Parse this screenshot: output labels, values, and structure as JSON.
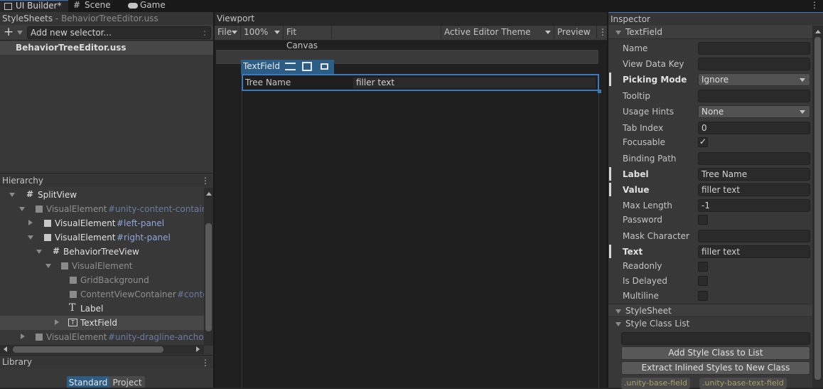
{
  "tabs": [
    {
      "label": "UI Builder*",
      "icon": "ui-builder-icon",
      "active": true
    },
    {
      "label": "Scene",
      "icon": "grid-icon",
      "active": false
    },
    {
      "label": "Game",
      "icon": "gamepad-icon",
      "active": false
    }
  ],
  "stylesheets": {
    "title": "StyleSheets",
    "subtitle": "- BehaviorTreeEditor.uss",
    "selector_placeholder": "Add new selector...",
    "selector_more": ":",
    "file": "BehaviorTreeEditor.uss"
  },
  "hierarchy": {
    "title": "Hierarchy",
    "rows": [
      {
        "name": "SplitView",
        "cls": ""
      },
      {
        "name": "VisualElement",
        "cls": "#unity-content-containe"
      },
      {
        "name": "VisualElement",
        "cls": "#left-panel"
      },
      {
        "name": "VisualElement",
        "cls": "#right-panel"
      },
      {
        "name": "BehaviorTreeView",
        "cls": ""
      },
      {
        "name": "VisualElement",
        "cls": ""
      },
      {
        "name": "GridBackground",
        "cls": ""
      },
      {
        "name": "ContentViewContainer",
        "cls": "#conte"
      },
      {
        "name": "Label",
        "cls": ""
      },
      {
        "name": "TextField",
        "cls": ""
      },
      {
        "name": "VisualElement",
        "cls": "#unity-dragline-anchor"
      }
    ]
  },
  "library": {
    "title": "Library",
    "tab_standard": "Standard",
    "tab_project": "Project"
  },
  "viewport": {
    "title": "Viewport",
    "file": "File",
    "zoom": "100%",
    "fit": "Fit Canvas",
    "theme": "Active Editor Theme",
    "preview": "Preview",
    "selected_label": "TextField",
    "field_label": "Tree Name",
    "field_value": "filler text"
  },
  "inspector": {
    "title": "Inspector",
    "section_textfield": "TextField",
    "name_label": "Name",
    "name_value": "",
    "viewdatakey_label": "View Data Key",
    "viewdatakey_value": "",
    "picking_label": "Picking Mode",
    "picking_value": "Ignore",
    "tooltip_label": "Tooltip",
    "tooltip_value": "",
    "usage_label": "Usage Hints",
    "usage_value": "None",
    "tabindex_label": "Tab Index",
    "tabindex_value": "0",
    "focusable_label": "Focusable",
    "focusable_check": "✓",
    "binding_label": "Binding Path",
    "binding_value": "",
    "label_label": "Label",
    "label_value": "Tree Name",
    "value_label": "Value",
    "value_value": "filler text",
    "maxlength_label": "Max Length",
    "maxlength_value": "-1",
    "password_label": "Password",
    "maskchar_label": "Mask Character",
    "maskchar_value": "",
    "text_label": "Text",
    "text_value": "filler text",
    "readonly_label": "Readonly",
    "delayed_label": "Is Delayed",
    "multiline_label": "Multiline",
    "section_stylesheet": "StyleSheet",
    "style_class_title": "Style Class List",
    "style_class_value": "",
    "add_class_button": "Add Style Class to List",
    "extract_button": "Extract Inlined Styles to New Class",
    "class_1": ".unity-base-field",
    "class_2": ".unity-base-text-field"
  },
  "colors": {
    "accent": "#2c5d87",
    "selection": "#3a79bb"
  }
}
